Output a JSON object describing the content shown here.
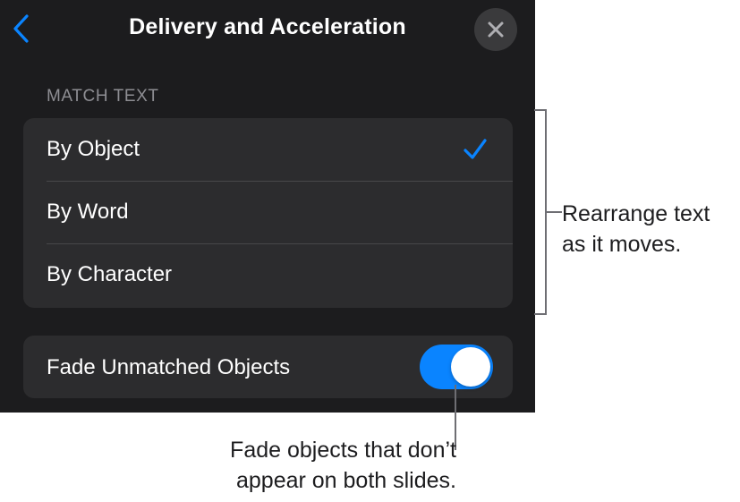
{
  "nav": {
    "title": "Delivery and Acceleration",
    "back_icon": "chevron-left-icon",
    "close_icon": "close-icon"
  },
  "match_text": {
    "header": "MATCH TEXT",
    "options": [
      {
        "label": "By Object",
        "selected": true
      },
      {
        "label": "By Word",
        "selected": false
      },
      {
        "label": "By Character",
        "selected": false
      }
    ]
  },
  "fade_toggle": {
    "label": "Fade Unmatched Objects",
    "on": true
  },
  "callouts": {
    "right_line1": "Rearrange text",
    "right_line2": "as it moves.",
    "bottom_line1": "Fade objects that don’t",
    "bottom_line2": "appear on both slides."
  },
  "colors": {
    "panel_bg": "#1c1c1e",
    "group_bg": "#2c2c2e",
    "accent": "#0a84ff",
    "secondary_text": "#8e8e93"
  }
}
